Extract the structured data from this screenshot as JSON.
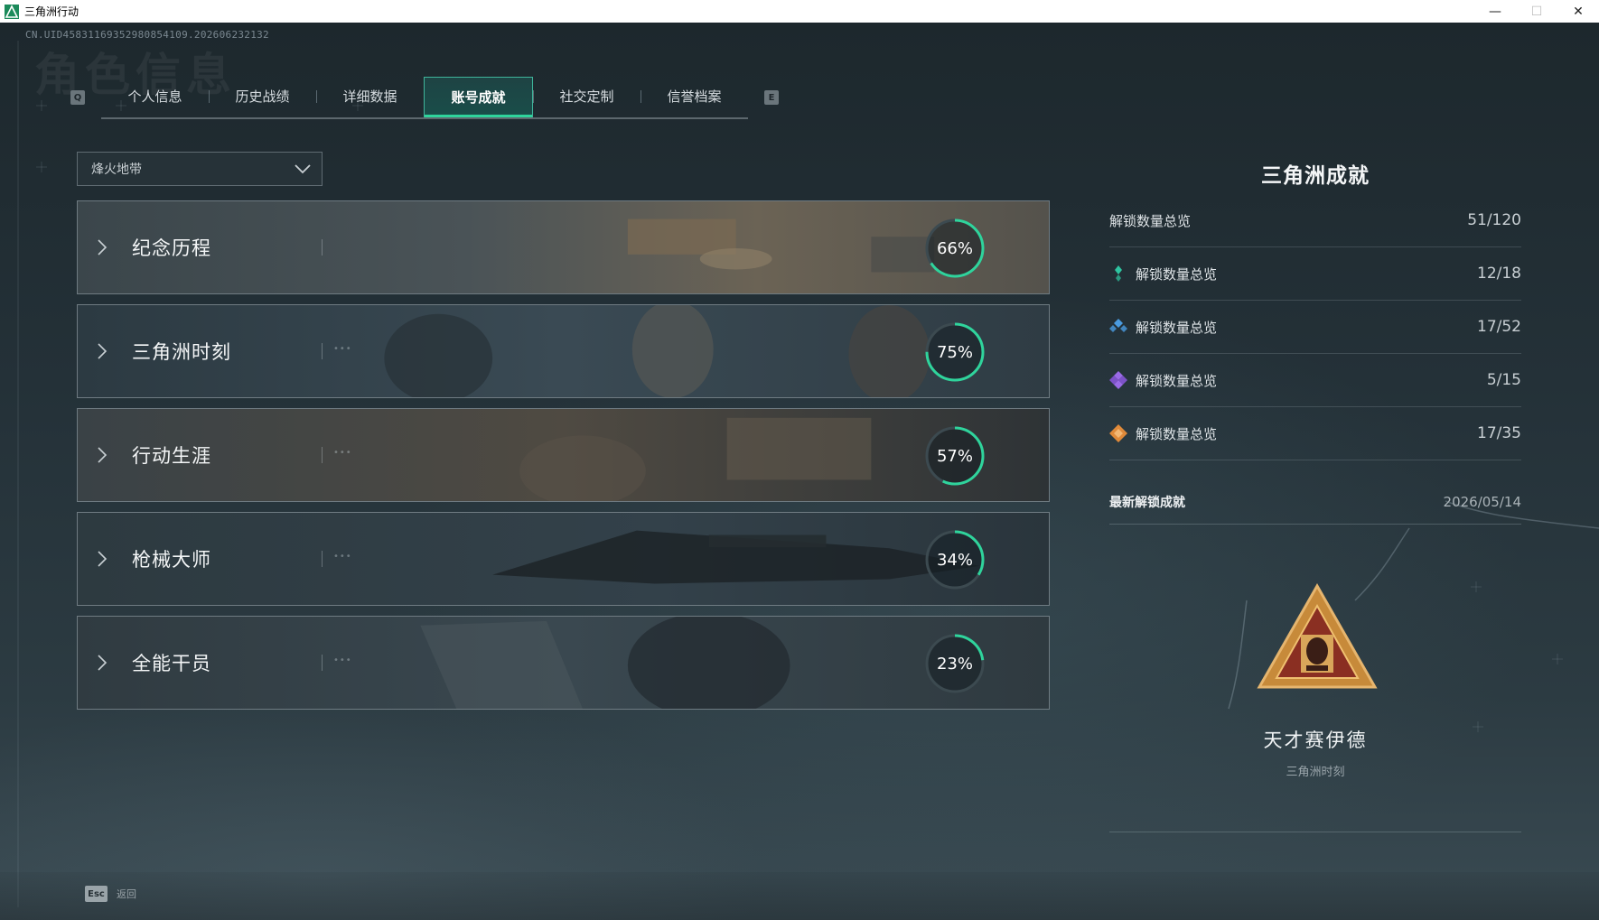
{
  "window": {
    "title": "三角洲行动",
    "minimize": "—",
    "maximize": "☐",
    "close": "✕"
  },
  "header": {
    "uid": "CN.UID458311693529808541​09.202606232132",
    "ghost_title": "角色信息"
  },
  "tabs": {
    "left_key": "Q",
    "right_key": "E",
    "items": [
      {
        "label": "个人信息"
      },
      {
        "label": "历史战绩"
      },
      {
        "label": "详细数据"
      },
      {
        "label": "账号成就"
      },
      {
        "label": "社交定制"
      },
      {
        "label": "信誉档案"
      }
    ],
    "active_index": 3
  },
  "filter": {
    "selected": "烽火地带"
  },
  "categories": [
    {
      "name": "纪念历程",
      "percent": 66,
      "percent_label": "66%"
    },
    {
      "name": "三角洲时刻",
      "percent": 75,
      "percent_label": "75%"
    },
    {
      "name": "行动生涯",
      "percent": 57,
      "percent_label": "57%"
    },
    {
      "name": "枪械大师",
      "percent": 34,
      "percent_label": "34%"
    },
    {
      "name": "全能干员",
      "percent": 23,
      "percent_label": "23%"
    }
  ],
  "summary": {
    "title": "三角洲成就",
    "total": {
      "label": "解锁数量总览",
      "value": "51/120"
    },
    "tiers": [
      {
        "label": "解锁数量总览",
        "value": "12/18",
        "icon": "green-diamond-icon",
        "color": "#2ec4a0"
      },
      {
        "label": "解锁数量总览",
        "value": "17/52",
        "icon": "blue-diamond-icon",
        "color": "#4a9be0"
      },
      {
        "label": "解锁数量总览",
        "value": "5/15",
        "icon": "purple-diamond-icon",
        "color": "#9a6ae6"
      },
      {
        "label": "解锁数量总览",
        "value": "17/35",
        "icon": "orange-diamond-icon",
        "color": "#e08a3a"
      }
    ],
    "latest": {
      "label": "最新解锁成就",
      "date": "2026/05/14",
      "achievement_name": "天才赛伊德",
      "achievement_category": "三角洲时刻",
      "badge_icon": "triangle-emblem-icon"
    }
  },
  "footer": {
    "esc_key": "Esc",
    "esc_label": "返回"
  },
  "colors": {
    "accent": "#2fd49c",
    "ring_track": "#3c4a50"
  }
}
